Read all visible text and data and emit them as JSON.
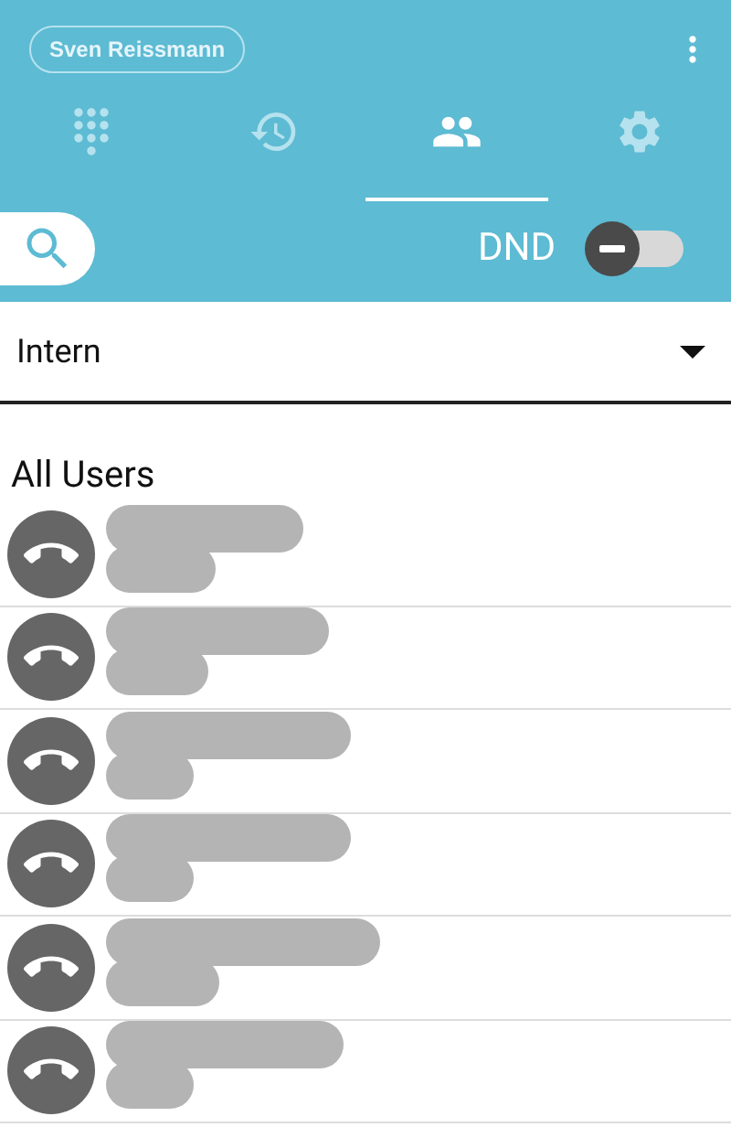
{
  "header": {
    "user": "Sven Reissmann"
  },
  "tabs": [
    {
      "kind": "dialpad",
      "selected": false
    },
    {
      "kind": "history",
      "selected": false
    },
    {
      "kind": "contacts",
      "selected": true
    },
    {
      "kind": "settings",
      "selected": false
    }
  ],
  "dnd": {
    "label": "DND",
    "on": false
  },
  "group_select": {
    "value": "Intern"
  },
  "section": "All Users",
  "users": [
    {
      "kind": "offline"
    },
    {
      "kind": "offline"
    },
    {
      "kind": "offline"
    },
    {
      "kind": "offline"
    },
    {
      "kind": "offline"
    },
    {
      "kind": "offline"
    }
  ]
}
